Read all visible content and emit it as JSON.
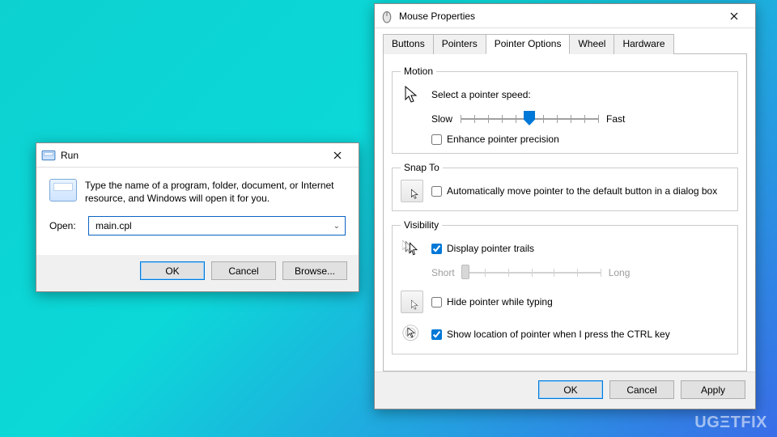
{
  "run": {
    "title": "Run",
    "description": "Type the name of a program, folder, document, or Internet resource, and Windows will open it for you.",
    "open_label": "Open:",
    "open_value": "main.cpl",
    "ok": "OK",
    "cancel": "Cancel",
    "browse": "Browse..."
  },
  "mp": {
    "title": "Mouse Properties",
    "tabs": [
      "Buttons",
      "Pointers",
      "Pointer Options",
      "Wheel",
      "Hardware"
    ],
    "motion": {
      "legend": "Motion",
      "select_speed": "Select a pointer speed:",
      "slow": "Slow",
      "fast": "Fast",
      "enhance": "Enhance pointer precision"
    },
    "snap": {
      "legend": "Snap To",
      "auto": "Automatically move pointer to the default button in a dialog box"
    },
    "visibility": {
      "legend": "Visibility",
      "trails": "Display pointer trails",
      "short": "Short",
      "long": "Long",
      "hide": "Hide pointer while typing",
      "ctrl": "Show location of pointer when I press the CTRL key"
    },
    "ok": "OK",
    "cancel": "Cancel",
    "apply": "Apply"
  },
  "watermark": "UGΞTFIX"
}
